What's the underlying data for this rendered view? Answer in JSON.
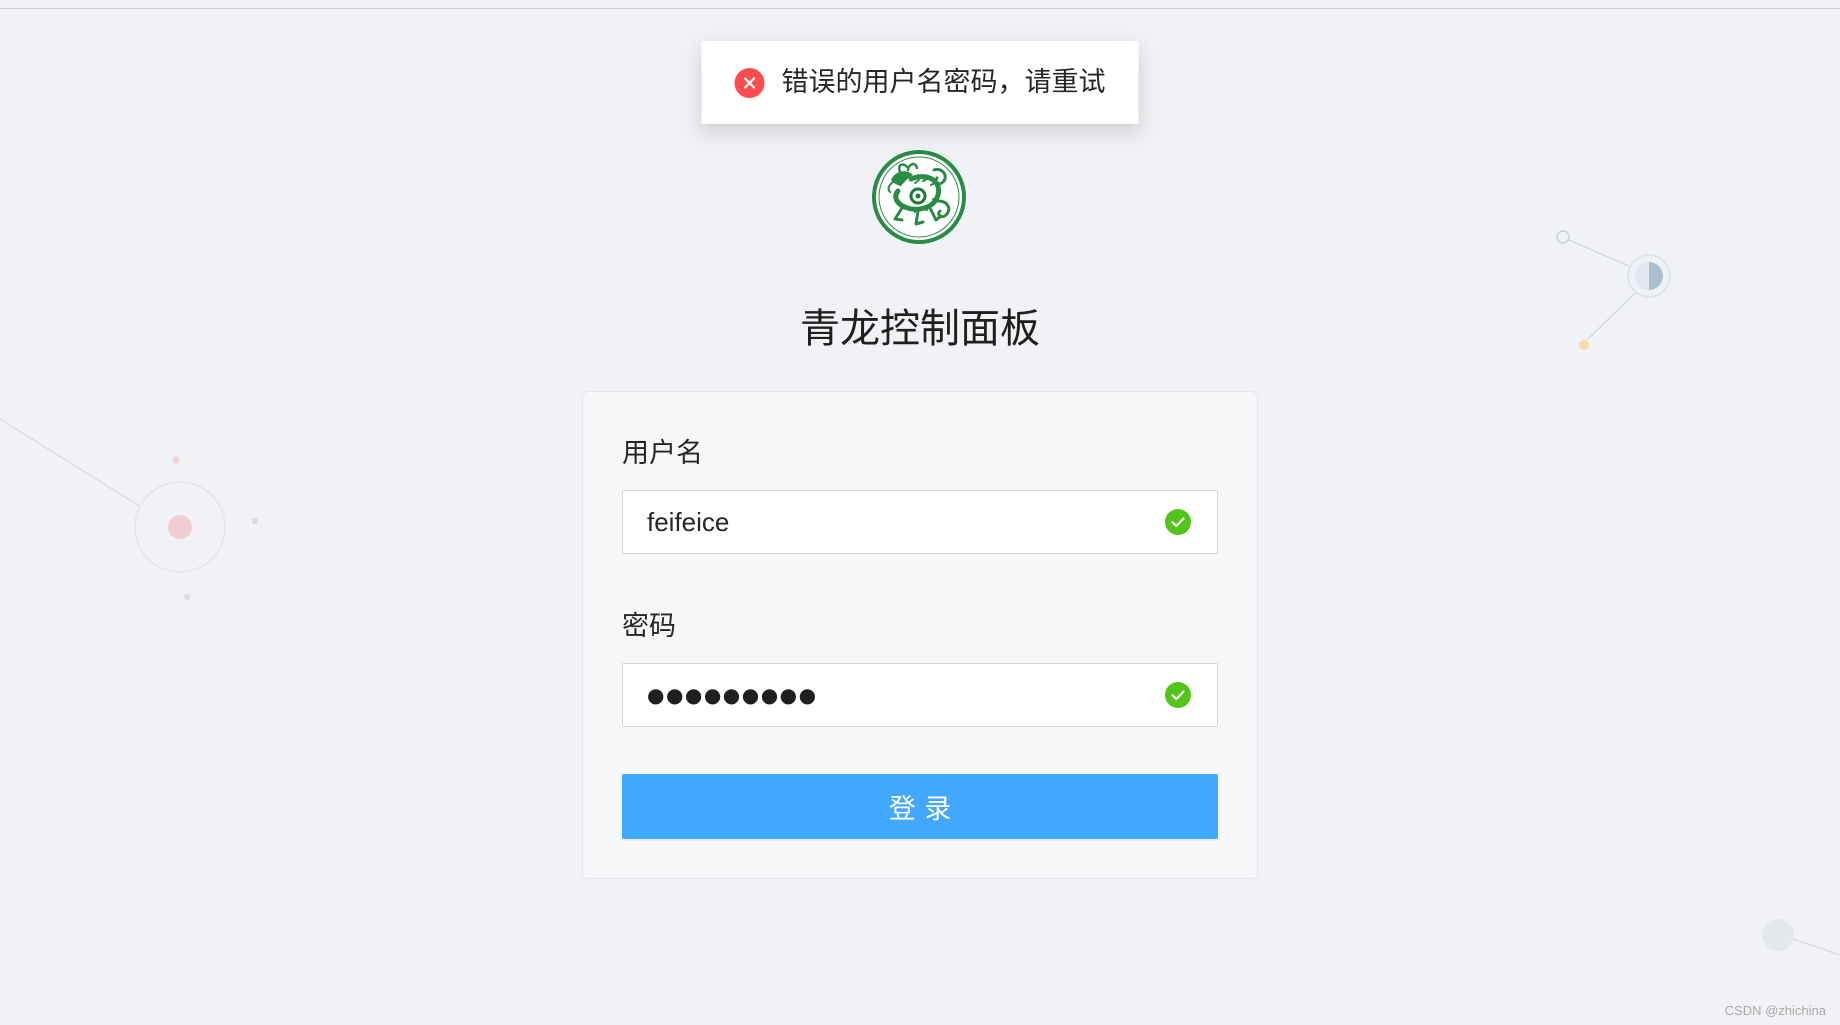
{
  "toast": {
    "type": "error",
    "icon": "error-circle-icon",
    "message": "错误的用户名密码，请重试"
  },
  "app": {
    "logo": "qinglong-dragon-logo",
    "title": "青龙控制面板"
  },
  "form": {
    "username": {
      "label": "用户名",
      "value": "feifeice",
      "status_icon": "check-circle-icon"
    },
    "password": {
      "label": "密码",
      "value_masked": "●●●●●●●●●",
      "status_icon": "check-circle-icon"
    },
    "submit_label": "登 录"
  },
  "watermark": "CSDN @zhichina",
  "colors": {
    "page_background": "#f1f2f5",
    "card_background": "#f6f7f9",
    "primary_button": "#40a9ff",
    "error": "#ff4d4f",
    "success": "#52c41a",
    "logo_green": "#2a8b45"
  }
}
